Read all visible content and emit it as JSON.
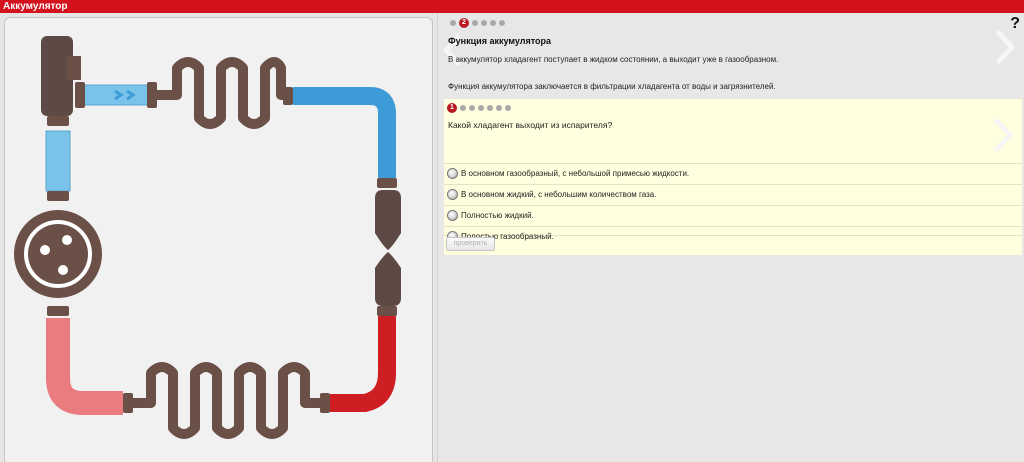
{
  "window": {
    "title": "Аккумулятор"
  },
  "help_label": "?",
  "info": {
    "current_step": "2",
    "step_count": 6,
    "title": "Функция аккумулятора",
    "paragraph1": "В аккумулятор хладагент поступает в жидком состоянии, а выходит уже в газообразном.",
    "paragraph2": "Функция аккумулятора заключается в фильтрации хладагента от воды и загрязнителей."
  },
  "quiz": {
    "current_step": "1",
    "step_count": 7,
    "question": "Какой хладагент выходит из испарителя?",
    "options": [
      "В основном газообразный, с небольшой примесью жидкости.",
      "В основном жидкий, с небольшим количеством газа.",
      "Полностью жидкий.",
      "Полостью газообразный."
    ],
    "check_label": "проверить"
  },
  "colors": {
    "brand_red": "#d3121d",
    "pipe_brown": "#6b5048",
    "pipe_blue": "#3d9bd8",
    "pipe_light_blue": "#79c3ea",
    "pipe_red": "#cf1d24",
    "pipe_pink": "#ea7b7f"
  },
  "icons": {
    "next_arrow": "chevron-right-icon",
    "prev_arrow": "chevron-left-icon",
    "radio": "radio-icon"
  }
}
